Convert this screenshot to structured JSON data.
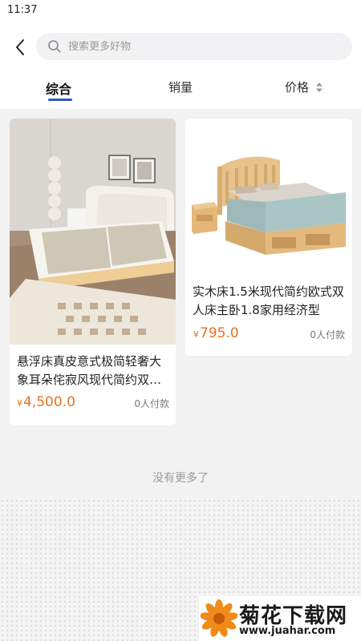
{
  "status_bar": {
    "time": "11:37"
  },
  "search": {
    "placeholder": "搜索更多好物"
  },
  "tabs": [
    {
      "label": "综合",
      "active": true
    },
    {
      "label": "销量",
      "active": false
    },
    {
      "label": "价格",
      "active": false
    }
  ],
  "products": [
    {
      "title": "悬浮床真皮意式极简轻奢大象耳朵侘寂风现代简约双人床",
      "currency": "¥",
      "price": "4,500.0",
      "buyers": "0人付款"
    },
    {
      "title": "实木床1.5米现代简约欧式双人床主卧1.8家用经济型",
      "currency": "¥",
      "price": "795.0",
      "buyers": "0人付款"
    }
  ],
  "footer": {
    "no_more": "没有更多了"
  },
  "watermark": {
    "name": "菊花下载网",
    "url": "www.juahar.com"
  },
  "colors": {
    "price": "#e8721c",
    "tab_indicator": "#2e58c8"
  },
  "icons": [
    "back-arrow-icon",
    "search-icon",
    "sort-updown-icon",
    "chrysanthemum-logo-icon"
  ]
}
